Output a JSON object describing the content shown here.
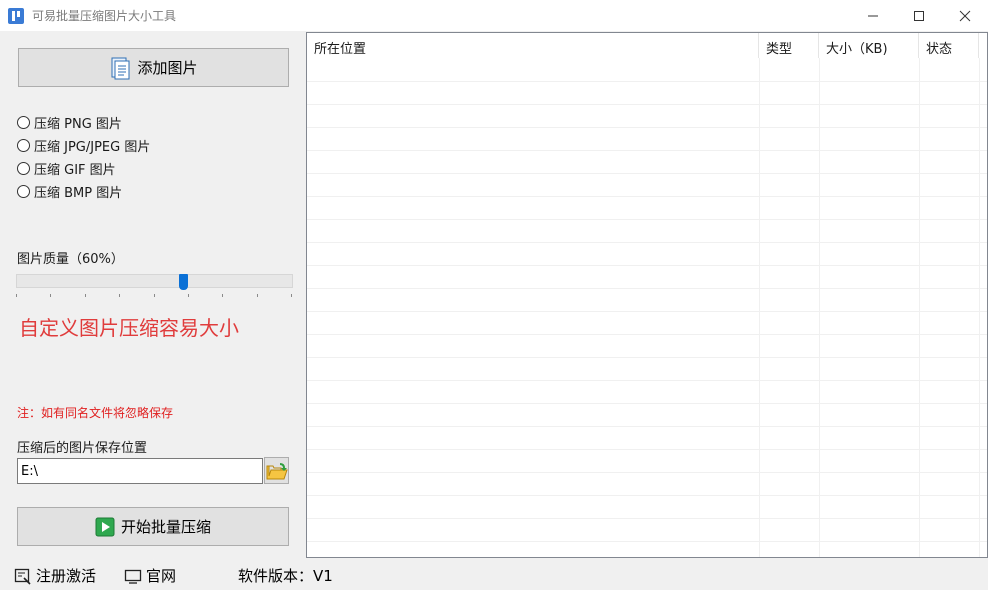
{
  "window": {
    "title": "可易批量压缩图片大小工具",
    "controls": [
      "minimize",
      "maximize",
      "close"
    ]
  },
  "left_panel": {
    "add_button_label": "添加图片",
    "add_button_icon": "document-icon",
    "compress_options": [
      {
        "label": "压缩 PNG 图片",
        "checked": false
      },
      {
        "label": "压缩 JPG/JPEG 图片",
        "checked": false
      },
      {
        "label": "压缩 GIF 图片",
        "checked": false
      },
      {
        "label": "压缩 BMP 图片",
        "checked": false
      }
    ],
    "quality_label": "图片质量（60%）",
    "quality_value": 0.6,
    "promo_text": "自定义图片压缩容易大小",
    "promo_color": "#e03c3c",
    "note_text": "注：如有同名文件将忽略保存",
    "note_color": "#e02020",
    "save_location_label": "压缩后的图片保存位置",
    "save_location_value": "E:\\",
    "browse_icon": "folder-open-icon",
    "start_button_label": "开始批量压缩",
    "start_button_icon": "play-icon"
  },
  "file_table": {
    "columns": [
      "所在位置",
      "类型",
      "大小（KB)",
      "状态"
    ],
    "rows": []
  },
  "statusbar": {
    "register_label": "注册激活",
    "register_icon": "register-icon",
    "website_label": "官网",
    "website_icon": "monitor-icon",
    "version_text": "软件版本：V1"
  }
}
